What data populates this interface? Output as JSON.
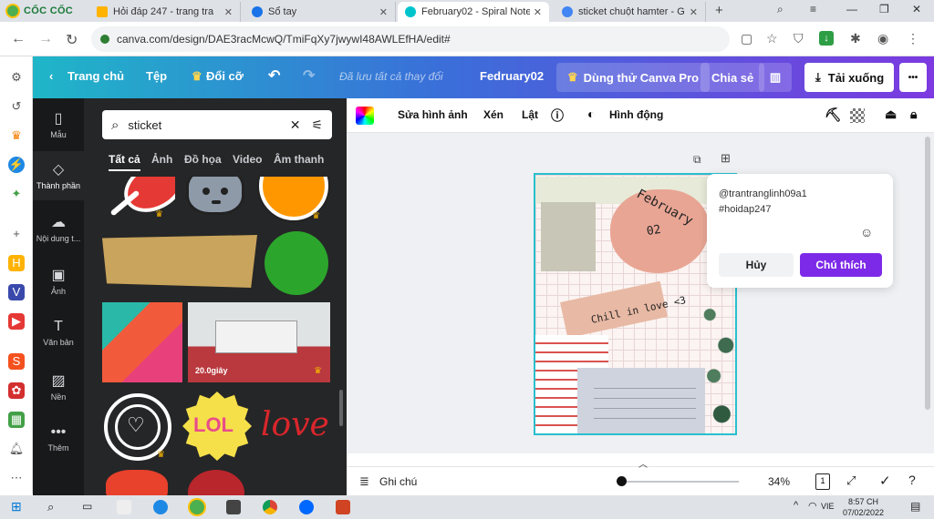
{
  "browser": {
    "brand": "CỐC CỐC",
    "tabs": [
      {
        "title": "Hỏi đáp 247 - trang tra",
        "color": "#e53935"
      },
      {
        "title": "Sổ tay",
        "color": "#1a73e8"
      },
      {
        "title": "February02 - Spiral Note",
        "color": "#00c4cc"
      },
      {
        "title": "sticket chuột hamter - G",
        "color": "#4285f4"
      }
    ],
    "new_tab": "+",
    "url": "canva.com/design/DAE3racMcwQ/TmiFqXy7jwywI48AWLEfHA/edit#"
  },
  "canva": {
    "home": "Trang chủ",
    "file": "Tệp",
    "resize": "Đổi cỡ",
    "saved": "Đã lưu tất cả thay đổi",
    "design_name": "Fedruary02",
    "pro": "Dùng thử Canva Pro",
    "share": "Chia sẻ",
    "download": "Tải xuống",
    "more": "•••",
    "rail": [
      {
        "label": "Mẫu",
        "icon": "▯"
      },
      {
        "label": "Thành phần",
        "icon": "◇"
      },
      {
        "label": "Nội dung t...",
        "icon": "☁"
      },
      {
        "label": "Ảnh",
        "icon": "▣"
      },
      {
        "label": "Văn bản",
        "icon": "T"
      },
      {
        "label": "Nền",
        "icon": "▨"
      },
      {
        "label": "Thêm",
        "icon": "•••"
      }
    ],
    "search_value": "sticket",
    "panel_tabs": [
      "Tất cả",
      "Ảnh",
      "Đồ họa",
      "Video",
      "Âm thanh"
    ],
    "video_duration": "20.0giây",
    "lol_text": "LOL",
    "love_text": "love",
    "toolbar": {
      "edit_image": "Sửa hình ảnh",
      "crop": "Xén",
      "flip": "Lật",
      "animate": "Hình động"
    },
    "design": {
      "february": "February",
      "day": "02",
      "chill": "Chill in love <3"
    },
    "comment": {
      "line1": "@trantranglinh09a1",
      "line2": "#hoidap247",
      "cancel": "Hủy",
      "submit": "Chú thích"
    },
    "notes": "Ghi chú",
    "zoom": "34%",
    "page": "1"
  },
  "taskbar": {
    "time": "8:57 CH",
    "date": "07/02/2022",
    "lang": "VIE"
  }
}
